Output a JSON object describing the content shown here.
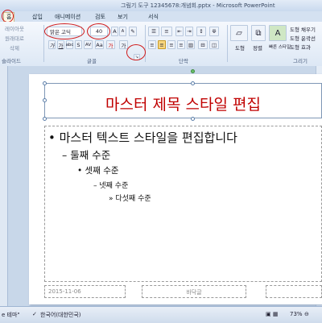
{
  "titlebar": {
    "title": "그림기 도구   12345678:개념회.pptx - Microsoft PowerPoint"
  },
  "tabs": [
    {
      "label": "홈"
    },
    {
      "label": "삽입"
    },
    {
      "label": "애니메이션"
    },
    {
      "label": "검토"
    },
    {
      "label": "보기"
    },
    {
      "label": "서식"
    }
  ],
  "ribbon": {
    "clipboard": {
      "layout": "레이아웃",
      "reset": "원래대로",
      "delete": "삭제",
      "group": "슬라이드"
    },
    "font": {
      "font_name": "맑은 고딕",
      "font_size": "40",
      "group": "글꼴"
    },
    "paragraph": {
      "group": "단락"
    },
    "drawing": {
      "shape": "도형",
      "arrange": "정렬",
      "quick_styles": "빠른 스타일",
      "fill": "도형 채우기",
      "outline": "도형 윤곽선",
      "effects": "도형 효과",
      "group": "그리기"
    }
  },
  "slide": {
    "title": "마스터 제목 스타일 편집",
    "bullets": [
      {
        "text": "마스터 텍스트 스타일을 편집합니다"
      },
      {
        "text": "둘째 수준"
      },
      {
        "text": "셋째 수준"
      },
      {
        "text": "넷째 수준"
      },
      {
        "text": "다섯째 수준"
      }
    ],
    "footer_date": "2015-11-06",
    "footer_text": "바닥글"
  },
  "statusbar": {
    "theme": "e 테마\"",
    "language": "한국어(대한민국)",
    "zoom": "73%"
  },
  "colors": {
    "title_red": "#c00000",
    "annotation_red": "#d01818"
  }
}
